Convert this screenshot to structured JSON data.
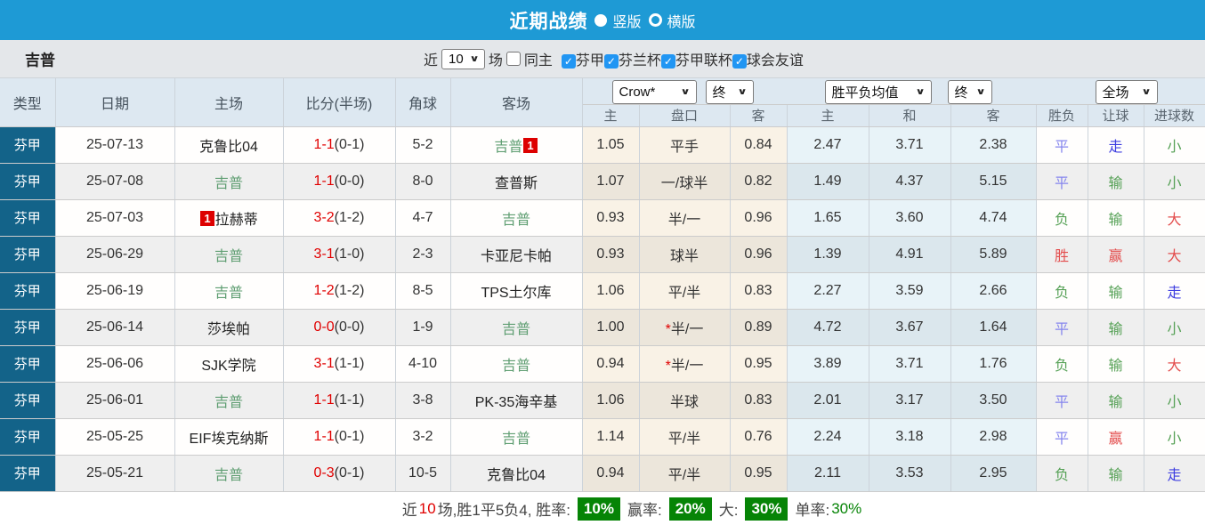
{
  "topbar": {
    "title": "近期战绩",
    "radio_vertical_label": "竖版",
    "radio_horizontal_label": "横版"
  },
  "filter": {
    "team": "吉普",
    "near_label": "近",
    "count_value": "10",
    "games_label": "场",
    "same_home_label": "同主",
    "leagues": [
      "芬甲",
      "芬兰杯",
      "芬甲联杯",
      "球会友谊"
    ]
  },
  "table": {
    "selects": {
      "company": "Crow*",
      "final1": "终",
      "avg": "胜平负均值",
      "final2": "终",
      "scope": "全场"
    },
    "headers": {
      "type": "类型",
      "date": "日期",
      "home": "主场",
      "score": "比分(半场)",
      "corner": "角球",
      "away": "客场",
      "sub": [
        "主",
        "盘口",
        "客",
        "主",
        "和",
        "客",
        "胜负",
        "让球",
        "进球数"
      ]
    },
    "rows": [
      {
        "league": "芬甲",
        "date": "25-07-13",
        "home": {
          "name": "克鲁比04",
          "green": false
        },
        "away": {
          "name": "吉普",
          "green": true,
          "badge": "1",
          "badge_pos": "after"
        },
        "score_ft": "1-1",
        "score_ht": "(0-1)",
        "corner": "5-2",
        "odds": [
          "1.05",
          "平手",
          "0.84"
        ],
        "pan_star": false,
        "avg": [
          "2.47",
          "3.71",
          "2.38"
        ],
        "res": [
          {
            "t": "平",
            "c": "blue"
          },
          {
            "t": "走",
            "c": "dblue"
          },
          {
            "t": "小",
            "c": "green"
          }
        ]
      },
      {
        "league": "芬甲",
        "date": "25-07-08",
        "home": {
          "name": "吉普",
          "green": true
        },
        "away": {
          "name": "查普斯",
          "green": false
        },
        "score_ft": "1-1",
        "score_ht": "(0-0)",
        "corner": "8-0",
        "odds": [
          "1.07",
          "一/球半",
          "0.82"
        ],
        "pan_star": false,
        "avg": [
          "1.49",
          "4.37",
          "5.15"
        ],
        "res": [
          {
            "t": "平",
            "c": "blue"
          },
          {
            "t": "输",
            "c": "green"
          },
          {
            "t": "小",
            "c": "green"
          }
        ]
      },
      {
        "league": "芬甲",
        "date": "25-07-03",
        "home": {
          "name": "拉赫蒂",
          "green": false,
          "badge": "1",
          "badge_pos": "before"
        },
        "away": {
          "name": "吉普",
          "green": true
        },
        "score_ft": "3-2",
        "score_ht": "(1-2)",
        "corner": "4-7",
        "odds": [
          "0.93",
          "半/一",
          "0.96"
        ],
        "pan_star": false,
        "avg": [
          "1.65",
          "3.60",
          "4.74"
        ],
        "res": [
          {
            "t": "负",
            "c": "green"
          },
          {
            "t": "输",
            "c": "green"
          },
          {
            "t": "大",
            "c": "red"
          }
        ]
      },
      {
        "league": "芬甲",
        "date": "25-06-29",
        "home": {
          "name": "吉普",
          "green": true
        },
        "away": {
          "name": "卡亚尼卡帕",
          "green": false
        },
        "score_ft": "3-1",
        "score_ht": "(1-0)",
        "corner": "2-3",
        "odds": [
          "0.93",
          "球半",
          "0.96"
        ],
        "pan_star": false,
        "avg": [
          "1.39",
          "4.91",
          "5.89"
        ],
        "res": [
          {
            "t": "胜",
            "c": "red"
          },
          {
            "t": "赢",
            "c": "red"
          },
          {
            "t": "大",
            "c": "red"
          }
        ]
      },
      {
        "league": "芬甲",
        "date": "25-06-19",
        "home": {
          "name": "吉普",
          "green": true
        },
        "away": {
          "name": "TPS土尔库",
          "green": false
        },
        "score_ft": "1-2",
        "score_ht": "(1-2)",
        "corner": "8-5",
        "odds": [
          "1.06",
          "平/半",
          "0.83"
        ],
        "pan_star": false,
        "avg": [
          "2.27",
          "3.59",
          "2.66"
        ],
        "res": [
          {
            "t": "负",
            "c": "green"
          },
          {
            "t": "输",
            "c": "green"
          },
          {
            "t": "走",
            "c": "dblue"
          }
        ]
      },
      {
        "league": "芬甲",
        "date": "25-06-14",
        "home": {
          "name": "莎埃帕",
          "green": false
        },
        "away": {
          "name": "吉普",
          "green": true
        },
        "score_ft": "0-0",
        "score_ht": "(0-0)",
        "corner": "1-9",
        "odds": [
          "1.00",
          "半/一",
          "0.89"
        ],
        "pan_star": true,
        "avg": [
          "4.72",
          "3.67",
          "1.64"
        ],
        "res": [
          {
            "t": "平",
            "c": "blue"
          },
          {
            "t": "输",
            "c": "green"
          },
          {
            "t": "小",
            "c": "green"
          }
        ]
      },
      {
        "league": "芬甲",
        "date": "25-06-06",
        "home": {
          "name": "SJK学院",
          "green": false
        },
        "away": {
          "name": "吉普",
          "green": true
        },
        "score_ft": "3-1",
        "score_ht": "(1-1)",
        "corner": "4-10",
        "odds": [
          "0.94",
          "半/一",
          "0.95"
        ],
        "pan_star": true,
        "avg": [
          "3.89",
          "3.71",
          "1.76"
        ],
        "res": [
          {
            "t": "负",
            "c": "green"
          },
          {
            "t": "输",
            "c": "green"
          },
          {
            "t": "大",
            "c": "red"
          }
        ]
      },
      {
        "league": "芬甲",
        "date": "25-06-01",
        "home": {
          "name": "吉普",
          "green": true
        },
        "away": {
          "name": "PK-35海辛基",
          "green": false
        },
        "score_ft": "1-1",
        "score_ht": "(1-1)",
        "corner": "3-8",
        "odds": [
          "1.06",
          "半球",
          "0.83"
        ],
        "pan_star": false,
        "avg": [
          "2.01",
          "3.17",
          "3.50"
        ],
        "res": [
          {
            "t": "平",
            "c": "blue"
          },
          {
            "t": "输",
            "c": "green"
          },
          {
            "t": "小",
            "c": "green"
          }
        ]
      },
      {
        "league": "芬甲",
        "date": "25-05-25",
        "home": {
          "name": "EIF埃克纳斯",
          "green": false
        },
        "away": {
          "name": "吉普",
          "green": true
        },
        "score_ft": "1-1",
        "score_ht": "(0-1)",
        "corner": "3-2",
        "odds": [
          "1.14",
          "平/半",
          "0.76"
        ],
        "pan_star": false,
        "avg": [
          "2.24",
          "3.18",
          "2.98"
        ],
        "res": [
          {
            "t": "平",
            "c": "blue"
          },
          {
            "t": "赢",
            "c": "red"
          },
          {
            "t": "小",
            "c": "green"
          }
        ]
      },
      {
        "league": "芬甲",
        "date": "25-05-21",
        "home": {
          "name": "吉普",
          "green": true
        },
        "away": {
          "name": "克鲁比04",
          "green": false
        },
        "score_ft": "0-3",
        "score_ht": "(0-1)",
        "corner": "10-5",
        "odds": [
          "0.94",
          "平/半",
          "0.95"
        ],
        "pan_star": false,
        "avg": [
          "2.11",
          "3.53",
          "2.95"
        ],
        "res": [
          {
            "t": "负",
            "c": "green"
          },
          {
            "t": "输",
            "c": "green"
          },
          {
            "t": "走",
            "c": "dblue"
          }
        ]
      }
    ]
  },
  "footer": {
    "segments": [
      {
        "t": "近",
        "c": "dark"
      },
      {
        "t": "10",
        "c": "red"
      },
      {
        "t": "场,胜1平5负4, 胜率:",
        "c": "dark"
      },
      {
        "t": "10%",
        "badge": true
      },
      {
        "t": "赢率:",
        "c": "dark"
      },
      {
        "t": "20%",
        "badge": true
      },
      {
        "t": "大:",
        "c": "dark"
      },
      {
        "t": "30%",
        "badge": true
      },
      {
        "t": "单率:",
        "c": "dark"
      },
      {
        "t": "30%",
        "c": "green"
      }
    ]
  },
  "colors": {
    "topbar_blue": "#1e9ad5",
    "type_cell_blue": "#136389",
    "team_green": "#5f9e72",
    "score_red": "#e00000",
    "badge_red": "#dd0000",
    "checkbox_blue": "#2196f3",
    "footer_badge_green": "#068406",
    "result_blue": "#8585ee",
    "result_deep_blue": "#3d3de0",
    "result_green": "#56a156",
    "result_red": "#e34d4d"
  }
}
